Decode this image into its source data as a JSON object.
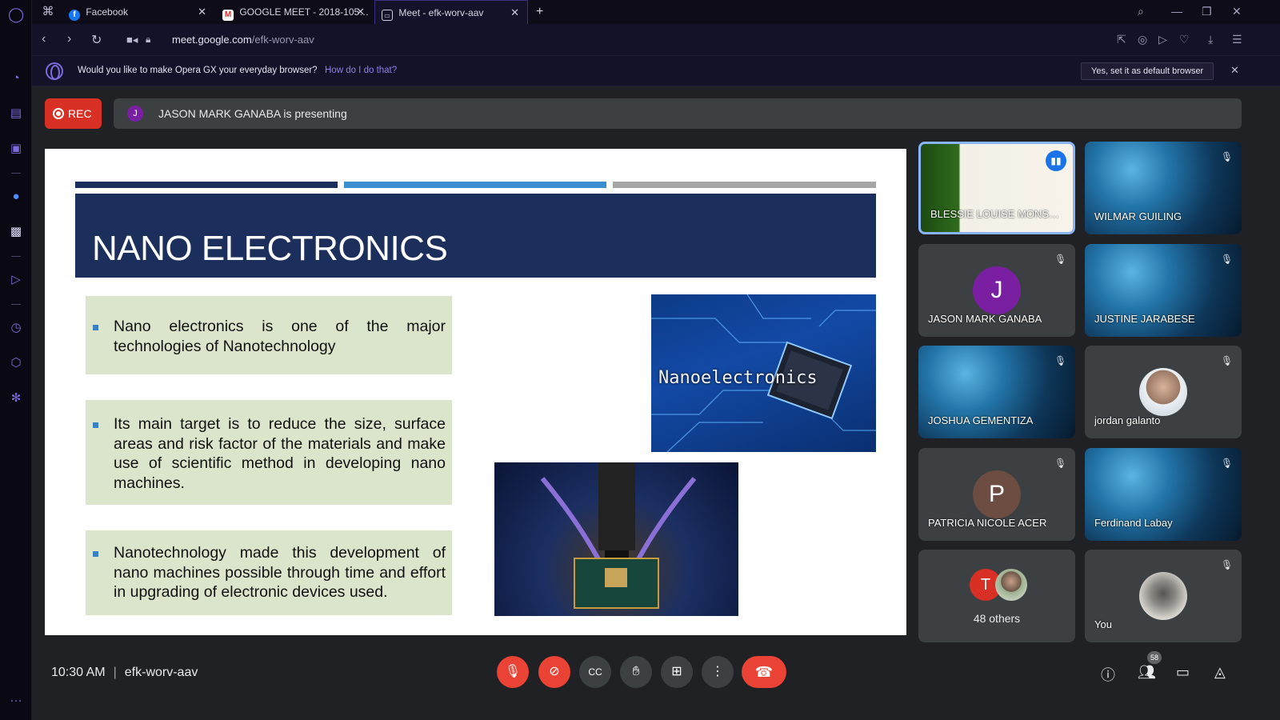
{
  "browser": {
    "tabs": [
      {
        "label": "Facebook",
        "icon": "facebook-icon"
      },
      {
        "label": "GOOGLE MEET - 2018-105…",
        "icon": "gmail-icon"
      },
      {
        "label": "Meet - efk-worv-aav",
        "icon": "meet-icon"
      }
    ],
    "url_domain": "meet.google.com",
    "url_path": "/efk-worv-aav",
    "infobar": {
      "message": "Would you like to make Opera GX your everyday browser?",
      "link": "How do I do that?",
      "button": "Yes, set it as default browser"
    }
  },
  "meet": {
    "rec_label": "REC",
    "presenter_initial": "J",
    "presenting_text": "JASON MARK GANABA is presenting",
    "slide": {
      "title": "NANO ELECTRONICS",
      "bullets": [
        "Nano electronics is one of the major technologies of Nanotechnology",
        "Its main target is to reduce the size, surface areas and risk factor of the materials and make use of scientific method in developing nano machines.",
        "Nanotechnology made this development of nano machines possible through time and effort in upgrading of electronic devices used."
      ],
      "image_label": "Nanoelectronics",
      "stripe_colors": [
        "#1b2e5c",
        "#3b8fd1",
        "#a6a6a6"
      ]
    },
    "participants": [
      {
        "name": "BLESSIE LOUISE MONS…",
        "kind": "video",
        "muted": false
      },
      {
        "name": "WILMAR GUILING",
        "kind": "video",
        "muted": true
      },
      {
        "name": "JASON MARK GANABA",
        "kind": "initial",
        "initial": "J",
        "color": "#7b1fa2",
        "muted": true
      },
      {
        "name": "JUSTINE JARABESE",
        "kind": "video",
        "muted": true
      },
      {
        "name": "JOSHUA GEMENTIZA",
        "kind": "video",
        "muted": true
      },
      {
        "name": "jordan galanto",
        "kind": "photo",
        "muted": true
      },
      {
        "name": "PATRICIA NICOLE ACER",
        "kind": "initial",
        "initial": "P",
        "color": "#6d4c41",
        "muted": true
      },
      {
        "name": "Ferdinand Labay",
        "kind": "video",
        "muted": true
      },
      {
        "name": "48 others",
        "kind": "others",
        "initial": "T",
        "color": "#d93025"
      },
      {
        "name": "You",
        "kind": "photo",
        "muted": true
      }
    ],
    "time": "10:30 AM",
    "meeting_code": "efk-worv-aav",
    "people_count": "58"
  }
}
